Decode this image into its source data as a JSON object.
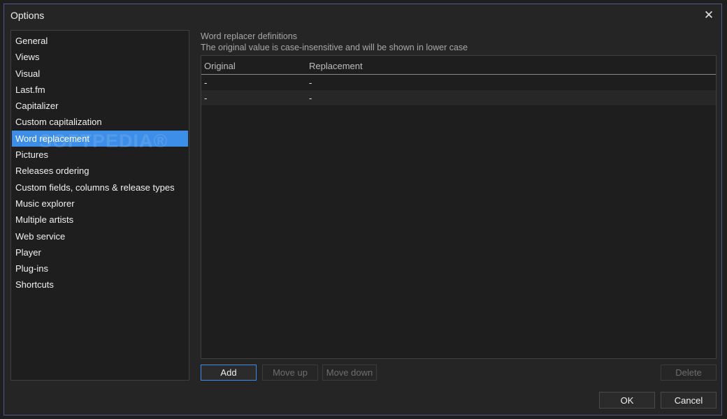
{
  "window": {
    "title": "Options",
    "close_glyph": "✕"
  },
  "nav": {
    "items": [
      {
        "label": "General",
        "selected": false
      },
      {
        "label": "Views",
        "selected": false
      },
      {
        "label": "Visual",
        "selected": false
      },
      {
        "label": "Last.fm",
        "selected": false
      },
      {
        "label": "Capitalizer",
        "selected": false
      },
      {
        "label": "Custom capitalization",
        "selected": false
      },
      {
        "label": "Word replacement",
        "selected": true
      },
      {
        "label": "Pictures",
        "selected": false
      },
      {
        "label": "Releases ordering",
        "selected": false
      },
      {
        "label": "Custom fields, columns & release types",
        "selected": false
      },
      {
        "label": "Music explorer",
        "selected": false
      },
      {
        "label": "Multiple artists",
        "selected": false
      },
      {
        "label": "Web service",
        "selected": false
      },
      {
        "label": "Player",
        "selected": false
      },
      {
        "label": "Plug-ins",
        "selected": false
      },
      {
        "label": "Shortcuts",
        "selected": false
      }
    ]
  },
  "watermark": "SOFTPEDIA®",
  "panel": {
    "heading": "Word replacer definitions",
    "subheading": "The original value is case-insensitive and will be shown in lower case",
    "table": {
      "columns": [
        "Original",
        "Replacement"
      ],
      "rows": [
        [
          "-",
          "-"
        ],
        [
          "-",
          "-"
        ]
      ]
    },
    "buttons": {
      "add": "Add",
      "move_up": "Move up",
      "move_down": "Move down",
      "delete": "Delete"
    }
  },
  "footer": {
    "ok": "OK",
    "cancel": "Cancel"
  },
  "colors": {
    "accent": "#3d8ee8",
    "background": "#252526"
  }
}
